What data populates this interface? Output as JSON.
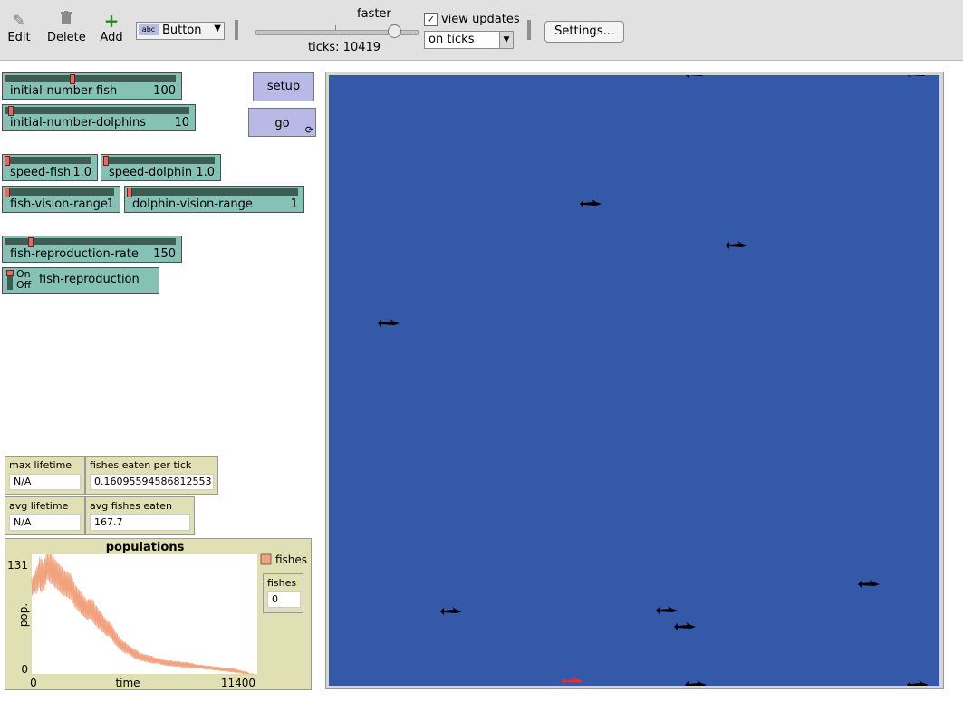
{
  "toolbar": {
    "edit_label": "Edit",
    "delete_label": "Delete",
    "add_label": "Add",
    "widget_type": "Button",
    "widget_type_icon_text": "abc",
    "speed_label": "faster",
    "speed_fraction": 0.85,
    "ticks_text": "ticks: 10419",
    "view_updates_checked": "✓",
    "view_updates_label": "view updates",
    "update_mode": "on ticks",
    "settings_label": "Settings..."
  },
  "sliders": {
    "initial_number_fish": {
      "label": "initial-number-fish",
      "value": "100",
      "fraction": 0.4
    },
    "initial_number_dolphins": {
      "label": "initial-number-dolphins",
      "value": "10",
      "fraction": 0.0
    },
    "speed_fish": {
      "label": "speed-fish",
      "value": "1.0",
      "fraction": 0.0
    },
    "speed_dolphin": {
      "label": "speed-dolphin",
      "value": "1.0",
      "fraction": 0.0
    },
    "fish_vision_range": {
      "label": "fish-vision-range",
      "value": "1",
      "fraction": 0.0
    },
    "dolphin_vision_range": {
      "label": "dolphin-vision-range",
      "value": "1",
      "fraction": 0.0
    },
    "fish_reproduction_rate": {
      "label": "fish-reproduction-rate",
      "value": "150",
      "fraction": 0.15
    }
  },
  "buttons": {
    "setup": "setup",
    "go": "go",
    "go_forever_icon": "arrows-cycle-icon"
  },
  "switch": {
    "label": "fish-reproduction",
    "on_text": "On",
    "off_text": "Off",
    "state": "off"
  },
  "monitors": {
    "max_lifetime": {
      "label": "max lifetime",
      "value": "N/A"
    },
    "fishes_eaten_per_tick": {
      "label": "fishes eaten per tick",
      "value": "0.16095594586812553"
    },
    "avg_lifetime": {
      "label": "avg lifetime",
      "value": "N/A"
    },
    "avg_fishes_eaten": {
      "label": "avg fishes eaten",
      "value": "167.7"
    },
    "fishes": {
      "label": "fishes",
      "value": "0"
    }
  },
  "plot": {
    "title": "populations",
    "legend": "fishes",
    "legend_color": "#f2a27e"
  },
  "chart_data": {
    "type": "line",
    "title": "populations",
    "xlabel": "time",
    "ylabel": "pop.",
    "xlim": [
      0,
      11400
    ],
    "ylim": [
      0,
      131
    ],
    "x_tick_labels": [
      "0",
      "11400"
    ],
    "y_tick_labels": [
      "0",
      "131"
    ],
    "series": [
      {
        "name": "fishes",
        "color": "#f2a27e",
        "x": [
          0,
          200,
          400,
          600,
          800,
          1000,
          1200,
          1400,
          1600,
          1800,
          2000,
          2200,
          2400,
          2600,
          2800,
          3000,
          3200,
          3400,
          3600,
          3800,
          4000,
          4200,
          4400,
          4600,
          4800,
          5000,
          5200,
          5400,
          5600,
          5800,
          6000,
          6200,
          6400,
          6600,
          6800,
          7000,
          7200,
          7400,
          7600,
          7800,
          8000,
          8200,
          8400,
          8600,
          8800,
          9000,
          9200,
          9400,
          9600,
          9800,
          10000,
          10200,
          10400,
          10600,
          10800,
          11000,
          11200
        ],
        "y": [
          95,
          100,
          110,
          105,
          122,
          115,
          110,
          105,
          100,
          98,
          95,
          85,
          80,
          75,
          70,
          72,
          65,
          60,
          55,
          50,
          48,
          40,
          35,
          30,
          28,
          25,
          22,
          20,
          18,
          17,
          16,
          15,
          14,
          13,
          12,
          12,
          11,
          11,
          10,
          10,
          9,
          9,
          8,
          8,
          7,
          7,
          6,
          6,
          5,
          5,
          4,
          4,
          3,
          2,
          1,
          0,
          0
        ],
        "amplitude": [
          10,
          14,
          18,
          16,
          18,
          16,
          15,
          15,
          14,
          14,
          13,
          12,
          12,
          11,
          11,
          12,
          11,
          10,
          9,
          8,
          8,
          7,
          6,
          6,
          5,
          5,
          5,
          4,
          4,
          4,
          4,
          3,
          3,
          3,
          3,
          3,
          3,
          3,
          3,
          3,
          3,
          2,
          2,
          2,
          2,
          2,
          2,
          2,
          2,
          2,
          2,
          2,
          1,
          1,
          1,
          0,
          0
        ]
      }
    ]
  },
  "world": {
    "background": "#3459a8",
    "fish_color": "#000000",
    "dolphin_color": "#e4302a"
  }
}
